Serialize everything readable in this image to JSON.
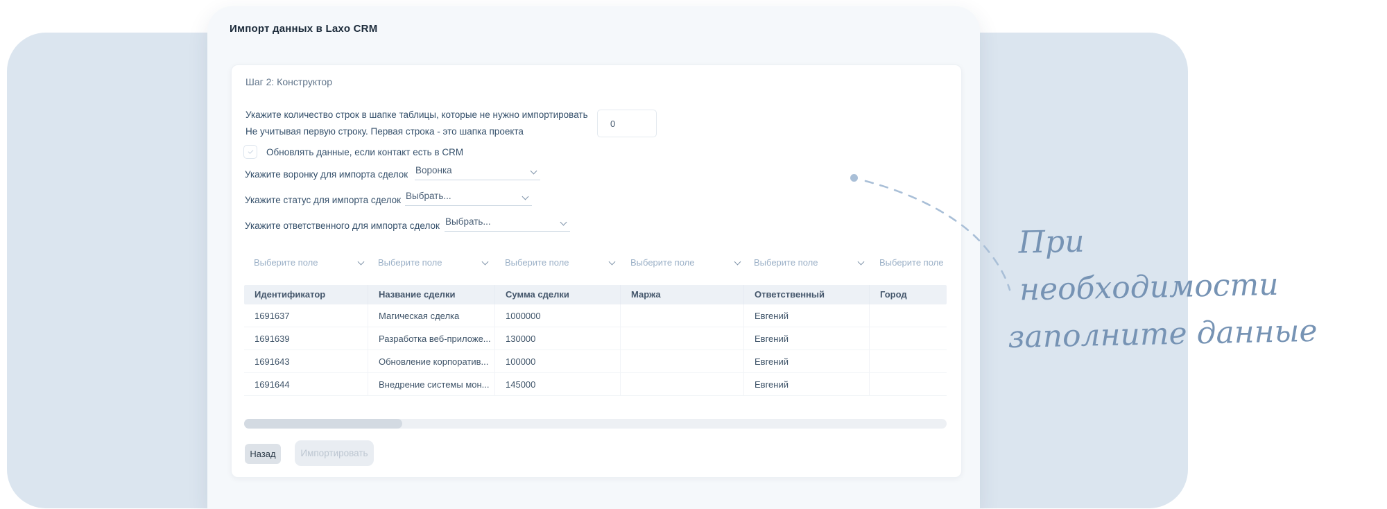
{
  "window": {
    "title": "Импорт данных в Laxo CRM"
  },
  "step_title": "Шаг 2: Конструктор",
  "header_rows_block": {
    "line1": "Укажите количество строк в шапке таблицы, которые не нужно импортировать",
    "line2": "Не учитывая первую строку. Первая строка - это шапка проекта",
    "input_value": "0"
  },
  "update_checkbox": {
    "label": "Обновлять данные, если контакт есть в CRM",
    "checked": false
  },
  "selects": [
    {
      "label": "Укажите воронку для импорта сделок",
      "value": "Воронка"
    },
    {
      "label": "Укажите статус для импорта сделок",
      "value": "Выбрать..."
    },
    {
      "label": "Укажите ответственного для импорта сделок",
      "value": "Выбрать..."
    }
  ],
  "field_select_placeholder": "Выберите поле",
  "table": {
    "columns": [
      "Идентификатор",
      "Название сделки",
      "Сумма сделки",
      "Маржа",
      "Ответственный",
      "Город"
    ],
    "rows": [
      [
        "1691637",
        "Магическая сделка",
        "1000000",
        "",
        "Евгений",
        ""
      ],
      [
        "1691639",
        "Разработка веб-приложе...",
        "130000",
        "",
        "Евгений",
        ""
      ],
      [
        "1691643",
        "Обновление корпоратив...",
        "100000",
        "",
        "Евгений",
        ""
      ],
      [
        "1691644",
        "Внедрение системы мон...",
        "145000",
        "",
        "Евгений",
        ""
      ]
    ]
  },
  "buttons": {
    "back": "Назад",
    "import": "Импортировать"
  },
  "annotation": {
    "line1": "При необходимости",
    "line2": "заполните данные"
  },
  "colors": {
    "background_card": "#dbe5ef",
    "panel": "#f5f8fb",
    "card": "#ffffff",
    "table_header_bg": "#edf1f6",
    "text_primary": "#35506b",
    "text_muted": "#9bb0c7",
    "annotation": "#7693b4",
    "disabled_button_bg": "#e9edf2",
    "disabled_button_text": "#bcc6d1"
  }
}
